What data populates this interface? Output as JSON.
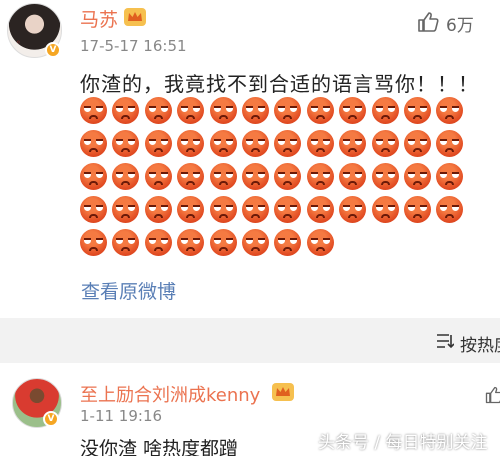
{
  "post": {
    "username": "马苏",
    "timestamp": "17-5-17 16:51",
    "like_count": "6万",
    "content": "你渣的，我竟找不到合适的语言骂你！！！",
    "emoji_rows": [
      12,
      12,
      12,
      12,
      8
    ],
    "emoji_name": "angry-face-emoji",
    "view_original": "查看原微博"
  },
  "sort": {
    "label": "按热度"
  },
  "comment": {
    "username": "至上励合刘洲成kenny",
    "timestamp": "1-11 19:16",
    "content": "没你渣 啥热度都蹭"
  },
  "watermark": "头条号 / 每日特别关注",
  "colors": {
    "username": "#eb7350",
    "link": "#5a7fb6",
    "verified_badge": "#f5a623",
    "divider_bg": "#f2f2f2"
  }
}
